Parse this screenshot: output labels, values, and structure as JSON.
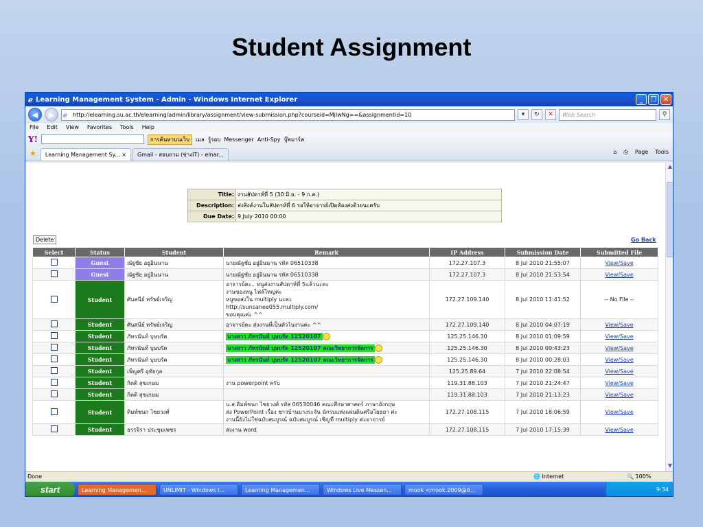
{
  "slide": {
    "title": "Student Assignment"
  },
  "window": {
    "title": "Learning Management System - Admin - Windows Internet Explorer",
    "url": "http://elearning.su.ac.th/elearning/admin/library/assignment/view-submission.php?courseid=MjIwNg==&assignmentid=10",
    "web_search_placeholder": "Web Search",
    "menu": [
      "File",
      "Edit",
      "View",
      "Favorites",
      "Tools",
      "Help"
    ],
    "yahoo": {
      "search_label": "การค้นหาบนเว็บ",
      "mail": "เมล",
      "news": "รู้รอบ",
      "messenger": "Messenger",
      "antispy": "Anti-Spy",
      "bookmarks": "บุ๊คมาร์ค"
    },
    "tabs": [
      {
        "label": "Learning Management Sy... ×"
      },
      {
        "label": "Gmail - สอบถาม (ช่างIT) - elnar..."
      }
    ],
    "tab_tools": {
      "page": "Page",
      "tools": "Tools"
    }
  },
  "assignment": {
    "title_label": "Title:",
    "title_value": "งานสัปดาห์ที่ 5 (30 มิ.ย. - 9 ก.ค.)",
    "desc_label": "Description:",
    "desc_value": "ส่งลิงค์งานในสัปดาห์ที่ 6 รอให้อาจารย์เปิดห้องส่งด้วยนะครับ",
    "due_label": "Due Date:",
    "due_value": "9 July 2010 00:00"
  },
  "actions": {
    "delete": "Delete",
    "go_back": "Go Back"
  },
  "table": {
    "headers": [
      "Select",
      "Status",
      "Student",
      "Remark",
      "IP Address",
      "Submission Date",
      "Submitted File"
    ],
    "rows": [
      {
        "status": "Guest",
        "student": "ณัฐชัย อยู่อินนาน",
        "remark": [
          "นายณัฐชัย อยู่อินนาน รหัส 06510338"
        ],
        "ip": "172.27.107.3",
        "date": "8 Jul 2010 21:55:07",
        "file": "View/Save"
      },
      {
        "status": "Guest",
        "student": "ณัฐชัย อยู่อินนาน",
        "remark": [
          "นายณัฐชัย อยู่อินนาน รหัส 06510338"
        ],
        "ip": "172.27.107.3",
        "date": "8 Jul 2010 21:53:54",
        "file": "View/Save"
      },
      {
        "status": "Student",
        "student": "ศันสนีย์ ทรัพย์เจริญ",
        "remark": [
          "อาจารย์คะ.. หนูส่งงานสัปดาห์ที่ 5แล้วนะคะ",
          "งานของหนู ไฟล์ใหญ่ค่ะ",
          "หนูขอส่งใน multiply นะคะ",
          "",
          "http://sunsanee055.multiply.com/",
          "",
          "ขอบคุณค่ะ ^^"
        ],
        "ip": "172.27.109.140",
        "date": "8 Jul 2010 11:41:52",
        "file": "-- No File --"
      },
      {
        "status": "Student",
        "student": "ศันสนีย์ ทรัพย์เจริญ",
        "remark": [
          "อาจารย์คะ ส่งงานที่เป็นตัวไบงานค่ะ ^^"
        ],
        "ip": "172.27.109.140",
        "date": "8 Jul 2010 04:07:19",
        "file": "View/Save"
      },
      {
        "status": "Student",
        "student": "ภัทรนันท์ บุษบรัต",
        "remark": [
          "นางสาว ภัทรนันท์ บุษบรัต 12520107"
        ],
        "ip": "125.25.146.30",
        "date": "8 Jul 2010 01:09:59",
        "file": "View/Save"
      },
      {
        "status": "Student",
        "student": "ภัทรนันท์ บุษบรัต",
        "remark": [
          "นางสาว ภัทรนันท์ บุษบรัต 12520107 คณะวิทยาการจัดการ"
        ],
        "ip": "125.25.146.30",
        "date": "8 Jul 2010 00:43:23",
        "file": "View/Save"
      },
      {
        "status": "Student",
        "student": "ภัทรนันท์ บุษบรัต",
        "remark": [
          "นางสาว ภัทรนันท์ บุษบรัต 12520107 คณะวิทยาการจัดการ"
        ],
        "ip": "125.25.146.30",
        "date": "8 Jul 2010 00:28:03",
        "file": "View/Save"
      },
      {
        "status": "Student",
        "student": "เพ็ญศรี อุทัยกุล",
        "remark": [
          ""
        ],
        "ip": "125.25.89.64",
        "date": "7 Jul 2010 22:08:54",
        "file": "View/Save"
      },
      {
        "status": "Student",
        "student": "กิตติ สุขเกษม",
        "remark": [
          "งาน powerpoint ครับ"
        ],
        "ip": "119.31.88.103",
        "date": "7 Jul 2010 21:24:47",
        "file": "View/Save"
      },
      {
        "status": "Student",
        "student": "กิตติ สุขเกษม",
        "remark": [
          ""
        ],
        "ip": "119.31.88.103",
        "date": "7 Jul 2010 21:13:23",
        "file": "View/Save"
      },
      {
        "status": "Student",
        "student": "ดิมพ์ชนก ไชยวงศ์",
        "remark": [
          "น.ส.ดิมพ์ชนก ไชยวงศ์ รหัส 06530046 คณะศึกษาศาสตร์ ภาษาอังกฤษ",
          "",
          "ส่ง PowerPoint เรื่อง ชาวบ้านบางระจัน นักรบแห่งแผ่นดินศรีอโยธยา ค่ะ",
          "",
          "งานนี้ยังไม่ใช่ฉบับสมบูรณ์ ฉบับสมบูรณ์ เชิญที่ multiply ค่ะอาจารย์"
        ],
        "ip": "172.27.108.115",
        "date": "7 Jul 2010 18:06:59",
        "file": "View/Save"
      },
      {
        "status": "Student",
        "student": "ธรรจิรา ประชุมเพชร",
        "remark": [
          "ส่งงาน word"
        ],
        "ip": "172.27.108.115",
        "date": "7 Jul 2010 17:15:39",
        "file": "View/Save"
      }
    ]
  },
  "statusbar": {
    "left": "Done",
    "zone": "Internet",
    "zoom": "100%"
  },
  "taskbar": {
    "start": "start",
    "tasks": [
      "Learning Managemen...",
      "UNLIMIT - Windows I...",
      "Learning Managemen...",
      "Windows Live Messen...",
      "mook <mook.2009@A..."
    ],
    "clock": "9:34"
  },
  "colors": {
    "guest": "#8f7de8",
    "student": "#1d7b1d",
    "highlight": "#1de51d",
    "header": "#686868"
  }
}
